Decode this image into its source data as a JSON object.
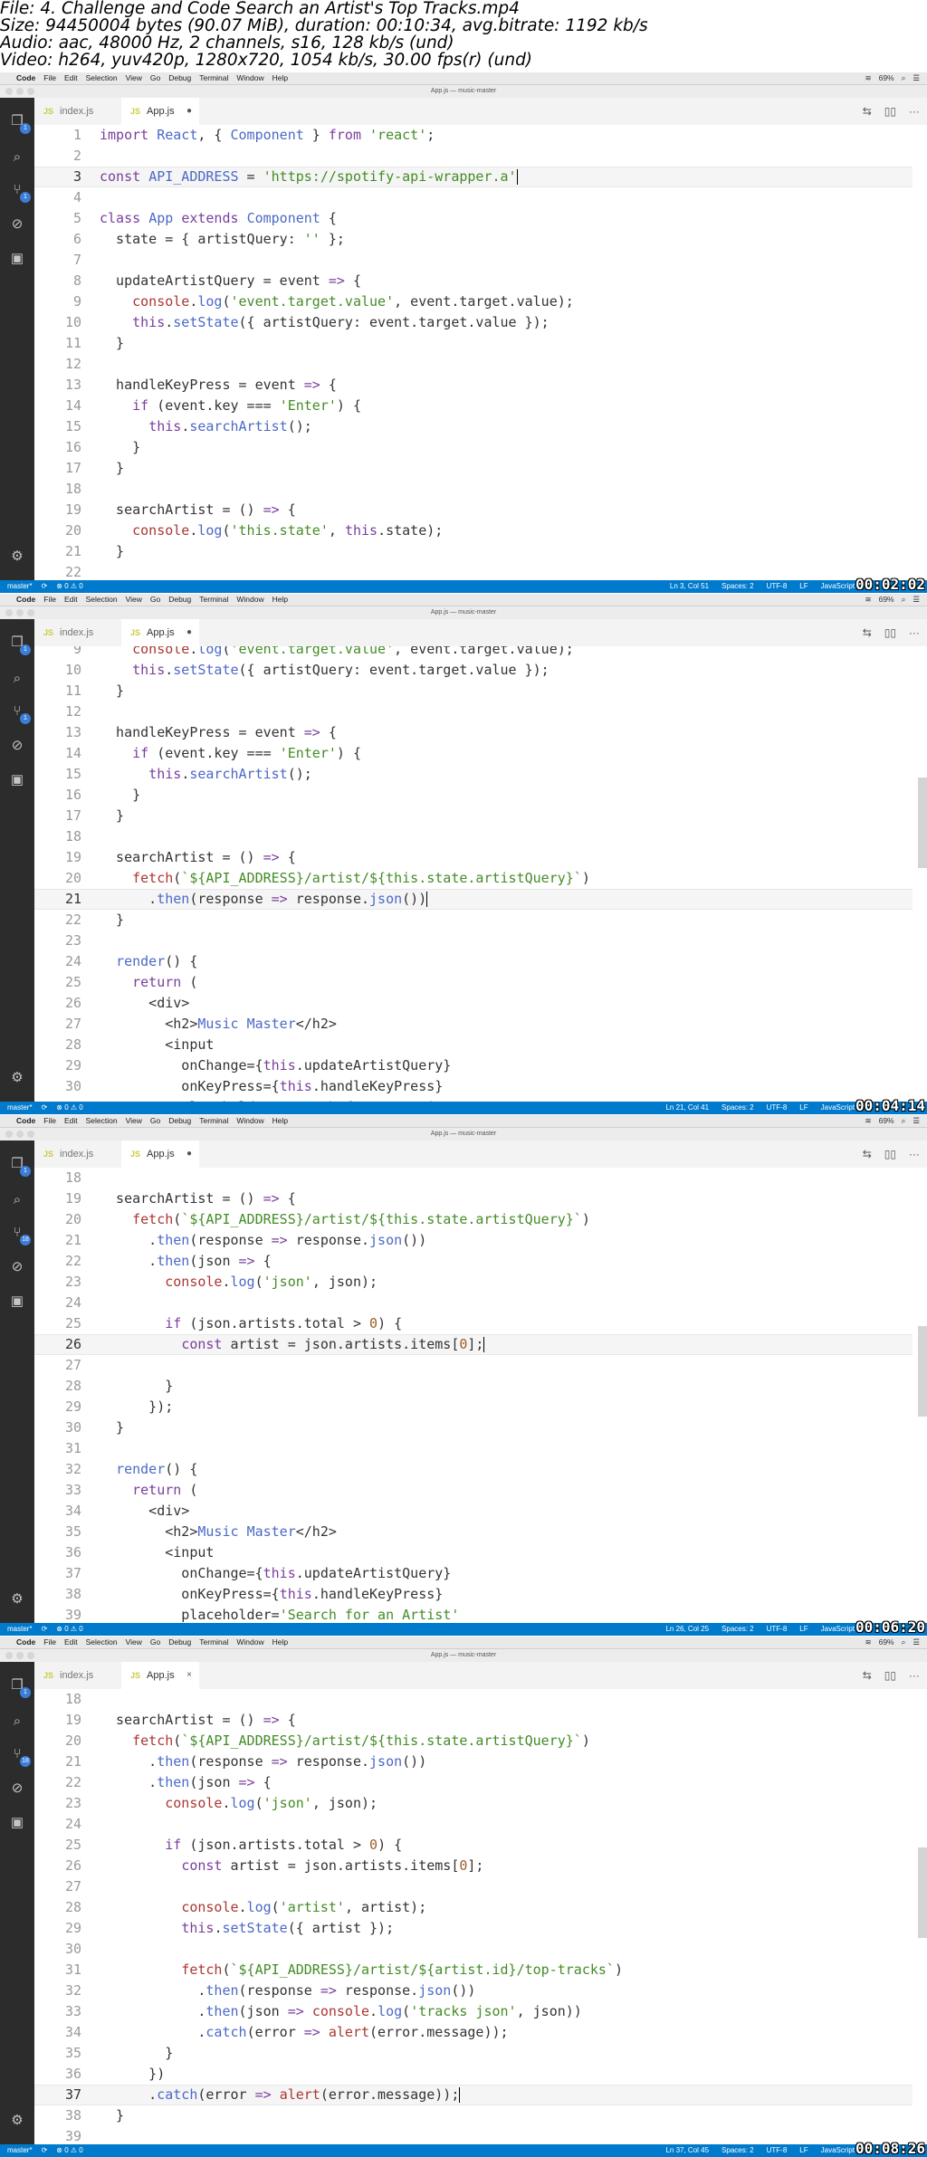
{
  "header": {
    "lines": [
      "File: 4. Challenge and Code Search an Artist's Top Tracks.mp4",
      "Size: 94450004 bytes (90.07 MiB), duration: 00:10:34, avg.bitrate: 1192 kb/s",
      "Audio: aac, 48000 Hz, 2 channels, s16, 128 kb/s (und)",
      "Video: h264, yuv420p, 1280x720, 1054 kb/s, 30.00 fps(r) (und)"
    ]
  },
  "menubar": {
    "apple": "",
    "items": [
      "Code",
      "File",
      "Edit",
      "Selection",
      "View",
      "Go",
      "Debug",
      "Terminal",
      "Window",
      "Help"
    ],
    "battery": "69%"
  },
  "window_title": "App.js — music-master",
  "tabs": [
    {
      "label": "index.js",
      "icon": "js-file-icon"
    },
    {
      "label": "App.js",
      "icon": "js-file-icon"
    }
  ],
  "colors": {
    "keyword": "#7a3e9d",
    "plain": "#333333",
    "string": "#448c27",
    "func": "#aa3731",
    "number": "#9c5d27",
    "property": "#4b69c6",
    "variable": "#7a3e9d",
    "statusbar": "#007acc",
    "activitybar": "#2c2c2c"
  },
  "status": {
    "branch": "master*",
    "problems": "⊗ 0 ⚠ 0",
    "spaces": "Spaces: 2",
    "encoding": "UTF-8",
    "eol": "LF",
    "language": "JavaScript"
  },
  "frames": [
    {
      "timestamp": "00:02:02",
      "status_position": "Ln 3, Col 51",
      "active_tab_mark": "●",
      "scm_badge": "1",
      "lines": [
        {
          "n": "1",
          "t": "import React, { Component } from 'react';"
        },
        {
          "n": "2",
          "t": ""
        },
        {
          "n": "3",
          "t": "const API_ADDRESS = 'https://spotify-api-wrapper.a'"
        },
        {
          "n": "4",
          "t": ""
        },
        {
          "n": "5",
          "t": "class App extends Component {"
        },
        {
          "n": "6",
          "t": "  state = { artistQuery: '' };"
        },
        {
          "n": "7",
          "t": ""
        },
        {
          "n": "8",
          "t": "  updateArtistQuery = event => {"
        },
        {
          "n": "9",
          "t": "    console.log('event.target.value', event.target.value);"
        },
        {
          "n": "10",
          "t": "    this.setState({ artistQuery: event.target.value });"
        },
        {
          "n": "11",
          "t": "  }"
        },
        {
          "n": "12",
          "t": ""
        },
        {
          "n": "13",
          "t": "  handleKeyPress = event => {"
        },
        {
          "n": "14",
          "t": "    if (event.key === 'Enter') {"
        },
        {
          "n": "15",
          "t": "      this.searchArtist();"
        },
        {
          "n": "16",
          "t": "    }"
        },
        {
          "n": "17",
          "t": "  }"
        },
        {
          "n": "18",
          "t": ""
        },
        {
          "n": "19",
          "t": "  searchArtist = () => {"
        },
        {
          "n": "20",
          "t": "    console.log('this.state', this.state);"
        },
        {
          "n": "21",
          "t": "  }"
        },
        {
          "n": "22",
          "t": ""
        }
      ]
    },
    {
      "timestamp": "00:04:14",
      "status_position": "Ln 21, Col 41",
      "active_tab_mark": "●",
      "scm_badge": "1",
      "lines": [
        {
          "n": "9",
          "t": "    console.log('event.target.value', event.target.value);"
        },
        {
          "n": "10",
          "t": "    this.setState({ artistQuery: event.target.value });"
        },
        {
          "n": "11",
          "t": "  }"
        },
        {
          "n": "12",
          "t": ""
        },
        {
          "n": "13",
          "t": "  handleKeyPress = event => {"
        },
        {
          "n": "14",
          "t": "    if (event.key === 'Enter') {"
        },
        {
          "n": "15",
          "t": "      this.searchArtist();"
        },
        {
          "n": "16",
          "t": "    }"
        },
        {
          "n": "17",
          "t": "  }"
        },
        {
          "n": "18",
          "t": ""
        },
        {
          "n": "19",
          "t": "  searchArtist = () => {"
        },
        {
          "n": "20",
          "t": "    fetch(`${API_ADDRESS}/artist/${this.state.artistQuery}`)"
        },
        {
          "n": "21",
          "t": "      .then(response => response.json())"
        },
        {
          "n": "22",
          "t": "  }"
        },
        {
          "n": "23",
          "t": ""
        },
        {
          "n": "24",
          "t": "  render() {"
        },
        {
          "n": "25",
          "t": "    return ("
        },
        {
          "n": "26",
          "t": "      <div>"
        },
        {
          "n": "27",
          "t": "        <h2>Music Master</h2>"
        },
        {
          "n": "28",
          "t": "        <input"
        },
        {
          "n": "29",
          "t": "          onChange={this.updateArtistQuery}"
        },
        {
          "n": "30",
          "t": "          onKeyPress={this.handleKeyPress}"
        },
        {
          "n": "31",
          "t": "          placeholder='Search for an Artist'"
        }
      ]
    },
    {
      "timestamp": "00:06:20",
      "status_position": "Ln 26, Col 25",
      "active_tab_mark": "●",
      "scm_badge": "18",
      "lines": [
        {
          "n": "18",
          "t": ""
        },
        {
          "n": "19",
          "t": "  searchArtist = () => {"
        },
        {
          "n": "20",
          "t": "    fetch(`${API_ADDRESS}/artist/${this.state.artistQuery}`)"
        },
        {
          "n": "21",
          "t": "      .then(response => response.json())"
        },
        {
          "n": "22",
          "t": "      .then(json => {"
        },
        {
          "n": "23",
          "t": "        console.log('json', json);"
        },
        {
          "n": "24",
          "t": ""
        },
        {
          "n": "25",
          "t": "        if (json.artists.total > 0) {"
        },
        {
          "n": "26",
          "t": "          const artist = json.artists.items[0];"
        },
        {
          "n": "27",
          "t": ""
        },
        {
          "n": "28",
          "t": "        }"
        },
        {
          "n": "29",
          "t": "      });"
        },
        {
          "n": "30",
          "t": "  }"
        },
        {
          "n": "31",
          "t": ""
        },
        {
          "n": "32",
          "t": "  render() {"
        },
        {
          "n": "33",
          "t": "    return ("
        },
        {
          "n": "34",
          "t": "      <div>"
        },
        {
          "n": "35",
          "t": "        <h2>Music Master</h2>"
        },
        {
          "n": "36",
          "t": "        <input"
        },
        {
          "n": "37",
          "t": "          onChange={this.updateArtistQuery}"
        },
        {
          "n": "38",
          "t": "          onKeyPress={this.handleKeyPress}"
        },
        {
          "n": "39",
          "t": "          placeholder='Search for an Artist'"
        }
      ]
    },
    {
      "timestamp": "00:08:26",
      "status_position": "Ln 37, Col 45",
      "active_tab_mark": "×",
      "scm_badge": "18",
      "lines": [
        {
          "n": "18",
          "t": ""
        },
        {
          "n": "19",
          "t": "  searchArtist = () => {"
        },
        {
          "n": "20",
          "t": "    fetch(`${API_ADDRESS}/artist/${this.state.artistQuery}`)"
        },
        {
          "n": "21",
          "t": "      .then(response => response.json())"
        },
        {
          "n": "22",
          "t": "      .then(json => {"
        },
        {
          "n": "23",
          "t": "        console.log('json', json);"
        },
        {
          "n": "24",
          "t": ""
        },
        {
          "n": "25",
          "t": "        if (json.artists.total > 0) {"
        },
        {
          "n": "26",
          "t": "          const artist = json.artists.items[0];"
        },
        {
          "n": "27",
          "t": ""
        },
        {
          "n": "28",
          "t": "          console.log('artist', artist);"
        },
        {
          "n": "29",
          "t": "          this.setState({ artist });"
        },
        {
          "n": "30",
          "t": ""
        },
        {
          "n": "31",
          "t": "          fetch(`${API_ADDRESS}/artist/${artist.id}/top-tracks`)"
        },
        {
          "n": "32",
          "t": "            .then(response => response.json())"
        },
        {
          "n": "33",
          "t": "            .then(json => console.log('tracks json', json))"
        },
        {
          "n": "34",
          "t": "            .catch(error => alert(error.message));"
        },
        {
          "n": "35",
          "t": "        }"
        },
        {
          "n": "36",
          "t": "      })"
        },
        {
          "n": "37",
          "t": "      .catch(error => alert(error.message));"
        },
        {
          "n": "38",
          "t": "  }"
        },
        {
          "n": "39",
          "t": ""
        }
      ]
    }
  ]
}
